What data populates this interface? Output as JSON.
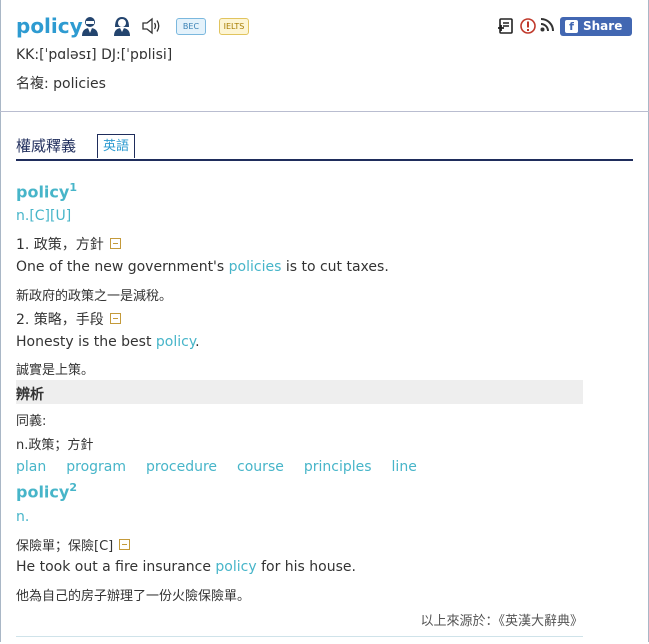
{
  "header": {
    "word": "policy",
    "tags": [
      "BEC",
      "IELTS"
    ],
    "share_label": "Share 0",
    "pronunciation": "KK:[ˈpɑləsɪ] DJ:[ˈpɒlisi]",
    "plural": "名複: policies"
  },
  "tabs": {
    "title": "權威釋義",
    "active": "英語"
  },
  "entries": {
    "e1": {
      "headword": "policy",
      "sup": "1",
      "pos": "n.[C][U]",
      "s1_def": "1. 政策，方針",
      "s1_ex_pre": "One of the new government's ",
      "s1_ex_link": "policies",
      "s1_ex_post": " is to cut taxes.",
      "s1_tr": "新政府的政策之一是減稅。",
      "s2_def": "2. 策略，手段",
      "s2_ex_pre": "Honesty is the best ",
      "s2_ex_link": "policy",
      "s2_ex_post": ".",
      "s2_tr": "誠實是上策。"
    },
    "analysis": {
      "title": "辨析",
      "syn_label": "同義:",
      "syn_pos": "n.政策；方針",
      "synonyms": [
        "plan",
        "program",
        "procedure",
        "course",
        "principles",
        "line"
      ]
    },
    "e2": {
      "headword": "policy",
      "sup": "2",
      "pos": "n.",
      "s1_def": "保險單；保險[C]",
      "s1_ex_pre": "He took out a fire insurance ",
      "s1_ex_link": "policy",
      "s1_ex_post": " for his house.",
      "s1_tr": "他為自己的房子辦理了一份火險保險單。"
    }
  },
  "source": "以上來源於：《英漢大辭典》",
  "colors": {
    "accent": "#2e9bd1",
    "link": "#47b5c9",
    "nav": "#1f2d5c",
    "facebook": "#4267b2"
  }
}
